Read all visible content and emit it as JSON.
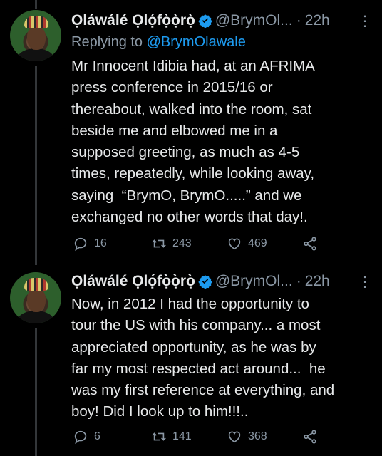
{
  "tweets": [
    {
      "display_name": "Ọláwálé Ọlọ́fọ̀ọ̀rọ̀",
      "handle": "@BrymOl...",
      "separator": "·",
      "time": "22h",
      "more": "⋮",
      "replying_prefix": "Replying to ",
      "replying_handle": "@BrymOlawale",
      "text": "Mr Innocent Idibia had, at an AFRIMA\npress conference in 2015/16 or\nthereabout, walked into the room, sat\nbeside me and elbowed me in a\nsupposed greeting, as much as 4-5\ntimes, repeatedly, while looking away,\nsaying  “BrymO, BrymO.....” and we\nexchanged no other words that day!.",
      "replies": "16",
      "retweets": "243",
      "likes": "469"
    },
    {
      "display_name": "Ọláwálé Ọlọ́fọ̀ọ̀rọ̀",
      "handle": "@BrymOl...",
      "separator": "·",
      "time": "22h",
      "more": "⋮",
      "text": "Now, in 2012 I had the opportunity to\ntour the US with his company... a most\nappreciated opportunity, as he was by\nfar my most respected act around...  he\nwas my first reference at everything, and\nboy! Did I look up to him!!!..",
      "replies": "6",
      "retweets": "141",
      "likes": "368"
    }
  ],
  "icons": {
    "verified_color": "#1d9bf0",
    "action_color": "#8b98a5",
    "reply": "reply-icon",
    "retweet": "retweet-icon",
    "like": "heart-icon",
    "share": "share-icon"
  }
}
